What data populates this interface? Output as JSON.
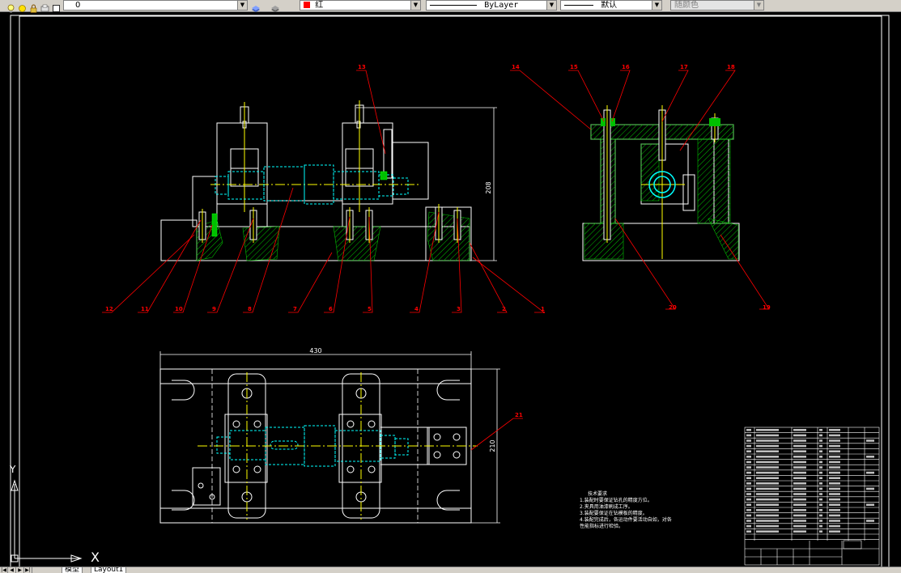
{
  "toolbar": {
    "layer_value": "0",
    "color_value": "红",
    "linetype_value": "ByLayer",
    "lineweight_value": "默认",
    "plotstyle_value": "随颜色"
  },
  "colors": {
    "background": "#000000",
    "outline": "#ffffff",
    "leader": "#ff0000",
    "hatch": "#00c000",
    "hidden": "#00ffff",
    "center": "#ffff00",
    "toolbar": "#d4d0c8"
  },
  "drawing": {
    "front_view": {
      "dimension_height": "208",
      "callouts": [
        "1",
        "2",
        "3",
        "4",
        "5",
        "6",
        "7",
        "8",
        "9",
        "10",
        "11",
        "12",
        "13"
      ]
    },
    "side_view": {
      "callouts": [
        "14",
        "15",
        "16",
        "17",
        "18",
        "19",
        "20"
      ]
    },
    "top_view": {
      "dimension_width": "430",
      "dimension_height": "210",
      "callouts": [
        "21"
      ]
    },
    "tech_notes": {
      "title": "技术要求",
      "lines": [
        "1.装配时要保证钻孔的精度方位。",
        "2.夹具用油漆刷成工序。",
        "3.装配要保证在钻模板的精度。",
        "4.装配完成后，各运动件要活动自如，对各",
        "性能指标进行检验。"
      ]
    }
  },
  "ucs": {
    "x_label": "X",
    "y_label": "Y"
  },
  "layout_tabs": {
    "model": "模型",
    "layout1": "Layout1"
  }
}
